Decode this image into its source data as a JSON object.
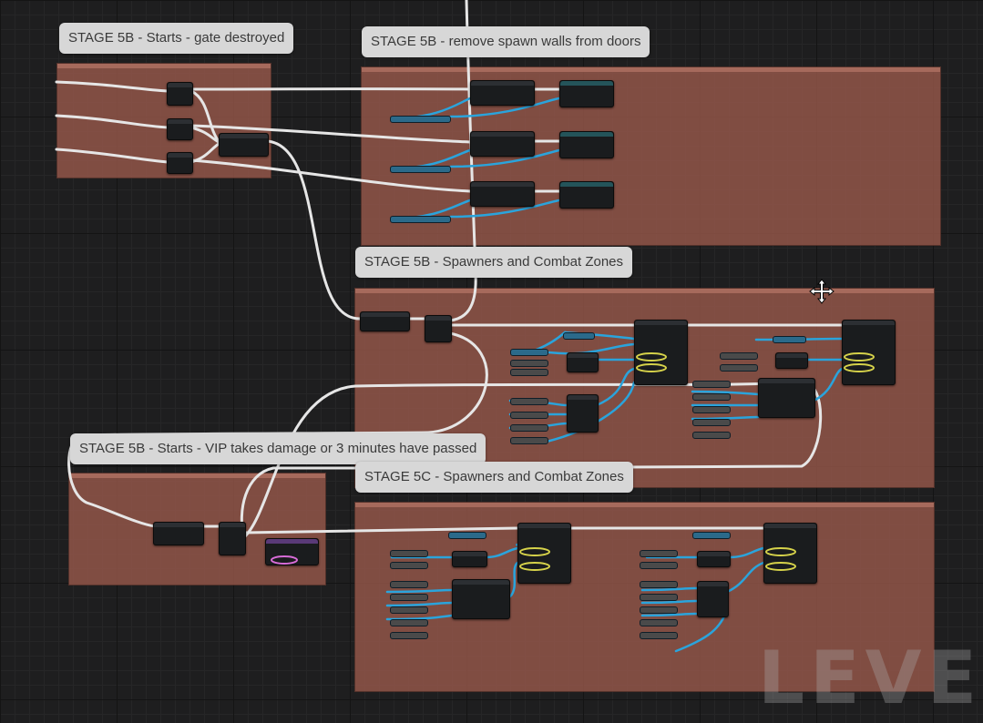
{
  "comments": {
    "c1": "STAGE 5B - Starts - gate destroyed",
    "c2": "STAGE 5B - remove spawn walls from doors",
    "c3": "STAGE 5B - Spawners and Combat Zones",
    "c4": "STAGE 5B - Starts - VIP takes damage or 3 minutes have passed",
    "c5": "STAGE 5C - Spawners and Combat Zones"
  },
  "watermark": "LEVEL I",
  "icons": {
    "cursor": "move-cursor-icon"
  },
  "colors": {
    "exec_wire": "#ebebeb",
    "data_wire": "#2aa4dc",
    "comment_fill": "#96584b",
    "bubble_fill": "#d7d7d7",
    "yellow_pin": "#d6d24a"
  }
}
